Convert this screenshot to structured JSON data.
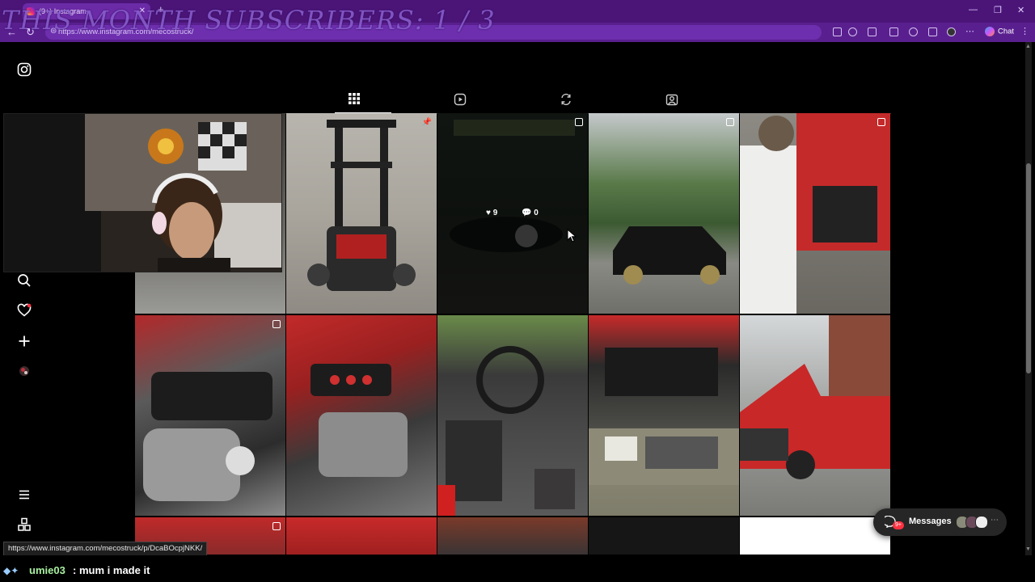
{
  "overlay": {
    "subscribers_text": "THIS MONTH SUBSCRIBERS: 1 / 3"
  },
  "browser": {
    "tab_title": "(9+) Instagram",
    "url": "https://www.instagram.com/mecostruck/",
    "chat_label": "Chat"
  },
  "profile_tabs": [
    {
      "name": "posts",
      "icon": "grid-icon"
    },
    {
      "name": "reels",
      "icon": "reels-icon"
    },
    {
      "name": "reposts",
      "icon": "repost-icon"
    },
    {
      "name": "tagged",
      "icon": "tagged-icon"
    }
  ],
  "sidebar": {
    "icons": [
      "instagram-logo-icon",
      "search-icon",
      "heart-icon",
      "create-icon",
      "profile-avatar",
      "menu-icon",
      "more-apps-icon"
    ]
  },
  "hovered_post": {
    "likes": "9",
    "comments": "0"
  },
  "status_url": "https://www.instagram.com/mecostruck/p/DcaBOcpjNKK/",
  "messages": {
    "label": "Messages",
    "badge": "9+"
  },
  "stream_chat": {
    "username": "umie03",
    "separator": ":",
    "message": "mum i made it"
  },
  "colors": {
    "browser_chrome": "#5a1f8f",
    "accent_red": "#ff3040",
    "page_bg": "#000000"
  }
}
